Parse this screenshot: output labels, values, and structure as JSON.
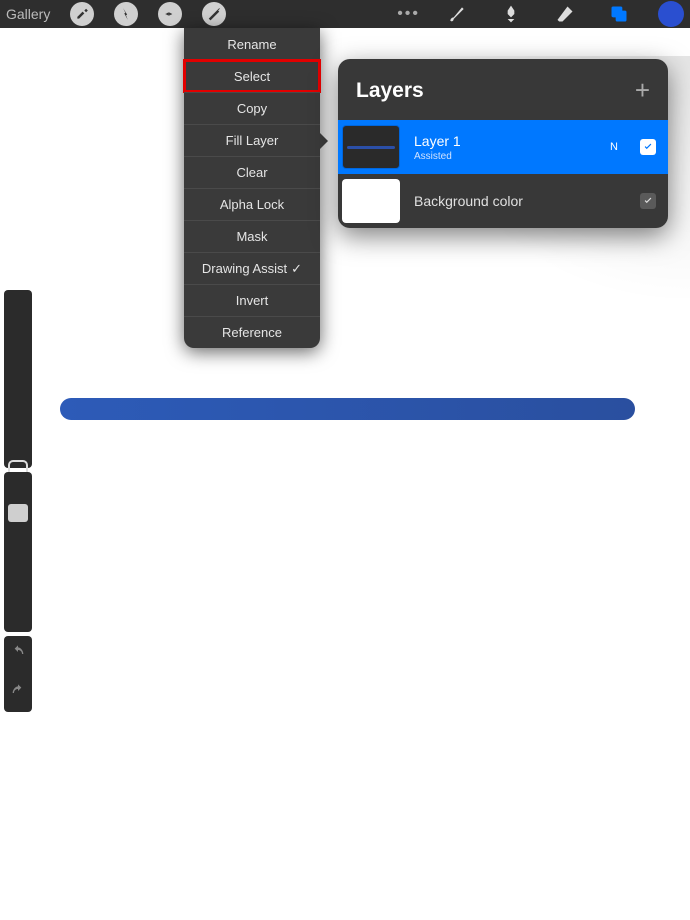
{
  "topbar": {
    "gallery": "Gallery",
    "icons": [
      "wrench-icon",
      "wand-icon",
      "s-icon",
      "arrow-icon"
    ],
    "right_icons": [
      "brush-icon",
      "smudge-icon",
      "eraser-icon",
      "layers-icon"
    ]
  },
  "context_menu": {
    "items": [
      {
        "label": "Rename"
      },
      {
        "label": "Select",
        "highlighted": true
      },
      {
        "label": "Copy"
      },
      {
        "label": "Fill Layer",
        "pointer": true
      },
      {
        "label": "Clear"
      },
      {
        "label": "Alpha Lock"
      },
      {
        "label": "Mask"
      },
      {
        "label": "Drawing Assist",
        "checked": true
      },
      {
        "label": "Invert"
      },
      {
        "label": "Reference"
      }
    ]
  },
  "layers_panel": {
    "title": "Layers",
    "add_glyph": "+",
    "rows": [
      {
        "name": "Layer 1",
        "subtitle": "Assisted",
        "blend_mode": "N",
        "checked": true,
        "selected": true,
        "thumb": "line"
      },
      {
        "name": "Background color",
        "checked": true,
        "thumb": "white"
      }
    ]
  },
  "colors": {
    "accent": "#0078ff",
    "brand_dot": "#2a4fd0",
    "highlight_box": "#e20000"
  }
}
